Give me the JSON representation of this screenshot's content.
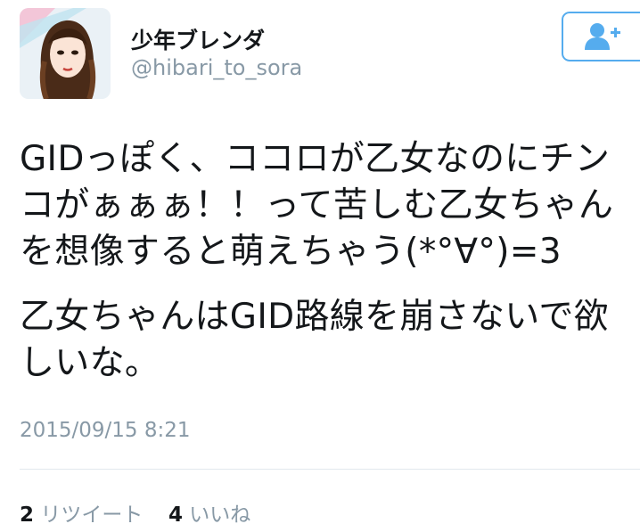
{
  "user": {
    "display_name": "少年ブレンダ",
    "handle": "@hibari_to_sora",
    "avatar_icon": "avatar-illustration"
  },
  "follow_button": {
    "icon": "add-user-icon",
    "color": "#55acee"
  },
  "tweet": {
    "paragraphs": [
      "GIDっぽく、ココロが乙女なのにチンコがぁぁぁ！！って苦しむ乙女ちゃんを想像すると萌えちゃう(*°∀°)=3",
      "乙女ちゃんはGID路線を崩さないで欲しいな。"
    ],
    "timestamp": "2015/09/15 8:21"
  },
  "stats": {
    "retweet_count": "2",
    "retweet_label": "リツイート",
    "like_count": "4",
    "like_label": "いいね"
  }
}
